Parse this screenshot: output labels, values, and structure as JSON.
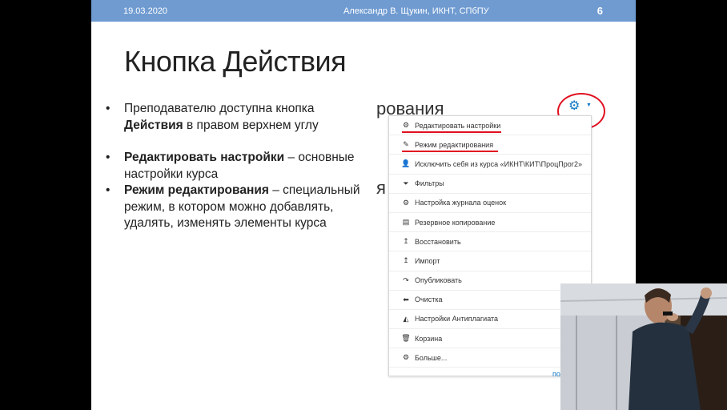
{
  "header": {
    "date": "19.03.2020",
    "author": "Александр В. Щукин, ИКНТ, СПбПУ",
    "page": "6"
  },
  "title": "Кнопка Действия",
  "bullets": [
    {
      "pre": "Преподавателю доступна кнопка ",
      "bold": "Действия",
      "post": " в правом верхнем углу"
    },
    {
      "pre": "",
      "bold": "Редактировать настройки",
      "post": " – основные настройки курса"
    },
    {
      "pre": "",
      "bold": "Режим редактирования",
      "post": " – специальный режим, в котором можно добавлять, удалять, изменять элементы курса"
    }
  ],
  "screenshot": {
    "bg_text_top": "рования",
    "bg_text_mid": "я",
    "peek_link": "пользователя",
    "menu_items": [
      {
        "icon": "gear-icon",
        "glyph": "⚙",
        "label": "Редактировать настройки",
        "underlined": true
      },
      {
        "icon": "pencil-icon",
        "glyph": "✎",
        "label": "Режим редактирования",
        "underlined": true
      },
      {
        "icon": "user-icon",
        "glyph": "👤",
        "label": "Исключить себя из курса «ИКНТ\\КИТ\\ПроцПрог2»",
        "underlined": false
      },
      {
        "icon": "filter-icon",
        "glyph": "⏷",
        "label": "Фильтры",
        "underlined": false
      },
      {
        "icon": "gear-icon",
        "glyph": "⚙",
        "label": "Настройка журнала оценок",
        "underlined": false
      },
      {
        "icon": "file-icon",
        "glyph": "▤",
        "label": "Резервное копирование",
        "underlined": false
      },
      {
        "icon": "upload-icon",
        "glyph": "↥",
        "label": "Восстановить",
        "underlined": false
      },
      {
        "icon": "upload-icon",
        "glyph": "↥",
        "label": "Импорт",
        "underlined": false
      },
      {
        "icon": "share-icon",
        "glyph": "↷",
        "label": "Опубликовать",
        "underlined": false
      },
      {
        "icon": "arrow-left-icon",
        "glyph": "⬅",
        "label": "Очистка",
        "underlined": false
      },
      {
        "icon": "chart-icon",
        "glyph": "◭",
        "label": "Настройки Антиплагиата",
        "underlined": false
      },
      {
        "icon": "trash-icon",
        "glyph": "🗑",
        "label": "Корзина",
        "underlined": false
      },
      {
        "icon": "gear-icon",
        "glyph": "⚙",
        "label": "Больше...",
        "underlined": false
      }
    ]
  }
}
